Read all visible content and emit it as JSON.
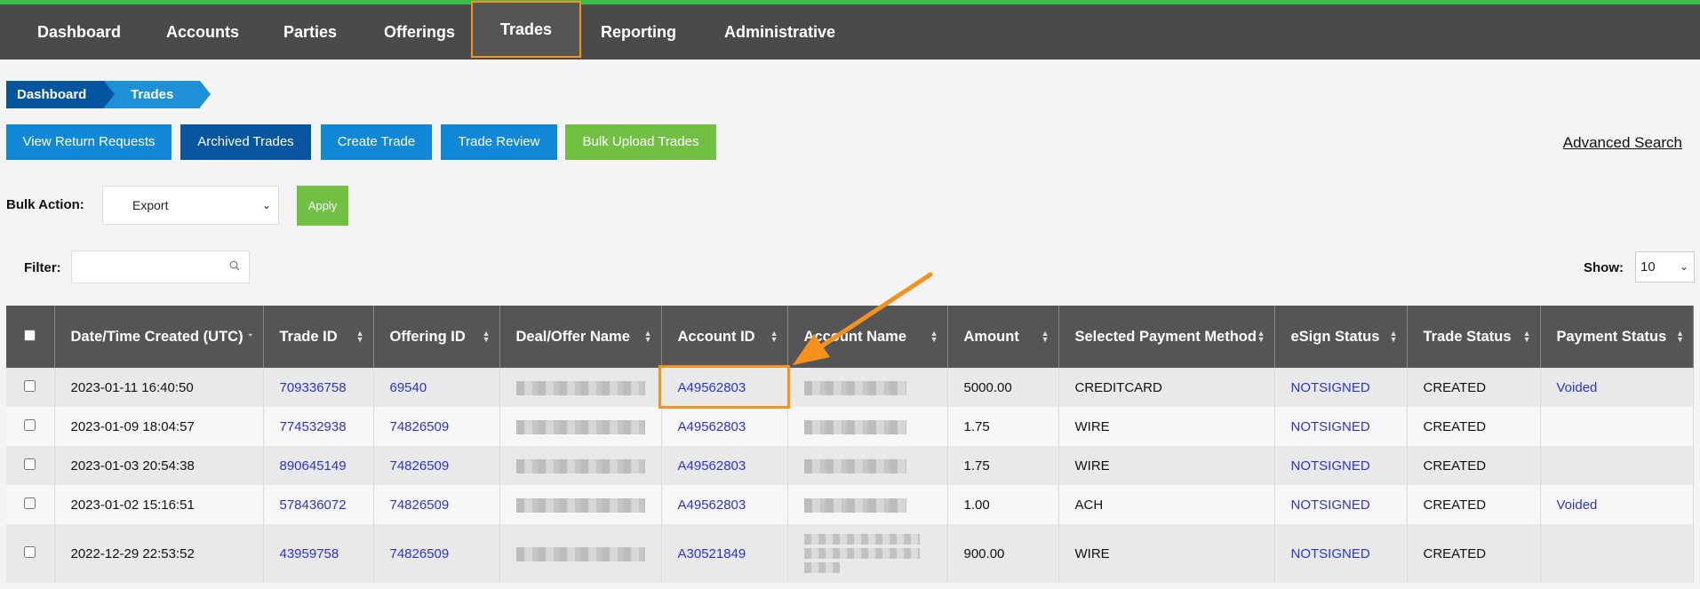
{
  "nav": {
    "items": [
      "Dashboard",
      "Accounts",
      "Parties",
      "Offerings",
      "Trades",
      "Reporting",
      "Administrative"
    ],
    "active": "Trades"
  },
  "breadcrumb": [
    "Dashboard",
    "Trades"
  ],
  "toolbar": {
    "view_return_requests": "View Return Requests",
    "archived_trades": "Archived Trades",
    "create_trade": "Create Trade",
    "trade_review": "Trade Review",
    "bulk_upload_trades": "Bulk Upload Trades",
    "advanced_search": "Advanced Search"
  },
  "bulk": {
    "label": "Bulk Action:",
    "selected": "Export",
    "apply": "Apply"
  },
  "filter": {
    "label": "Filter:",
    "value": ""
  },
  "show": {
    "label": "Show:",
    "value": "10"
  },
  "table": {
    "headers": [
      "Date/Time Created (UTC)",
      "Trade ID",
      "Offering ID",
      "Deal/Offer Name",
      "Account ID",
      "Account Name",
      "Amount",
      "Selected Payment Method",
      "eSign Status",
      "Trade Status",
      "Payment Status"
    ],
    "rows": [
      {
        "date": "2023-01-11 16:40:50",
        "trade_id": "709336758",
        "offering_id": "69540",
        "account_id": "A49562803",
        "amount": "5000.00",
        "method": "CREDITCARD",
        "esign": "NOTSIGNED",
        "status": "CREATED",
        "payment": "Voided"
      },
      {
        "date": "2023-01-09 18:04:57",
        "trade_id": "774532938",
        "offering_id": "74826509",
        "account_id": "A49562803",
        "amount": "1.75",
        "method": "WIRE",
        "esign": "NOTSIGNED",
        "status": "CREATED",
        "payment": ""
      },
      {
        "date": "2023-01-03 20:54:38",
        "trade_id": "890645149",
        "offering_id": "74826509",
        "account_id": "A49562803",
        "amount": "1.75",
        "method": "WIRE",
        "esign": "NOTSIGNED",
        "status": "CREATED",
        "payment": ""
      },
      {
        "date": "2023-01-02 15:16:51",
        "trade_id": "578436072",
        "offering_id": "74826509",
        "account_id": "A49562803",
        "amount": "1.00",
        "method": "ACH",
        "esign": "NOTSIGNED",
        "status": "CREATED",
        "payment": "Voided"
      },
      {
        "date": "2022-12-29 22:53:52",
        "trade_id": "43959758",
        "offering_id": "74826509",
        "account_id": "A30521849",
        "amount": "900.00",
        "method": "WIRE",
        "esign": "NOTSIGNED",
        "status": "CREATED",
        "payment": ""
      }
    ]
  },
  "colors": {
    "nav_bg": "#4a4a4a",
    "highlight": "#f5921e",
    "link": "#2a33d6",
    "green": "#71c043",
    "blue": "#1289d6"
  },
  "annotation": {
    "highlight_target": "A49562803"
  }
}
